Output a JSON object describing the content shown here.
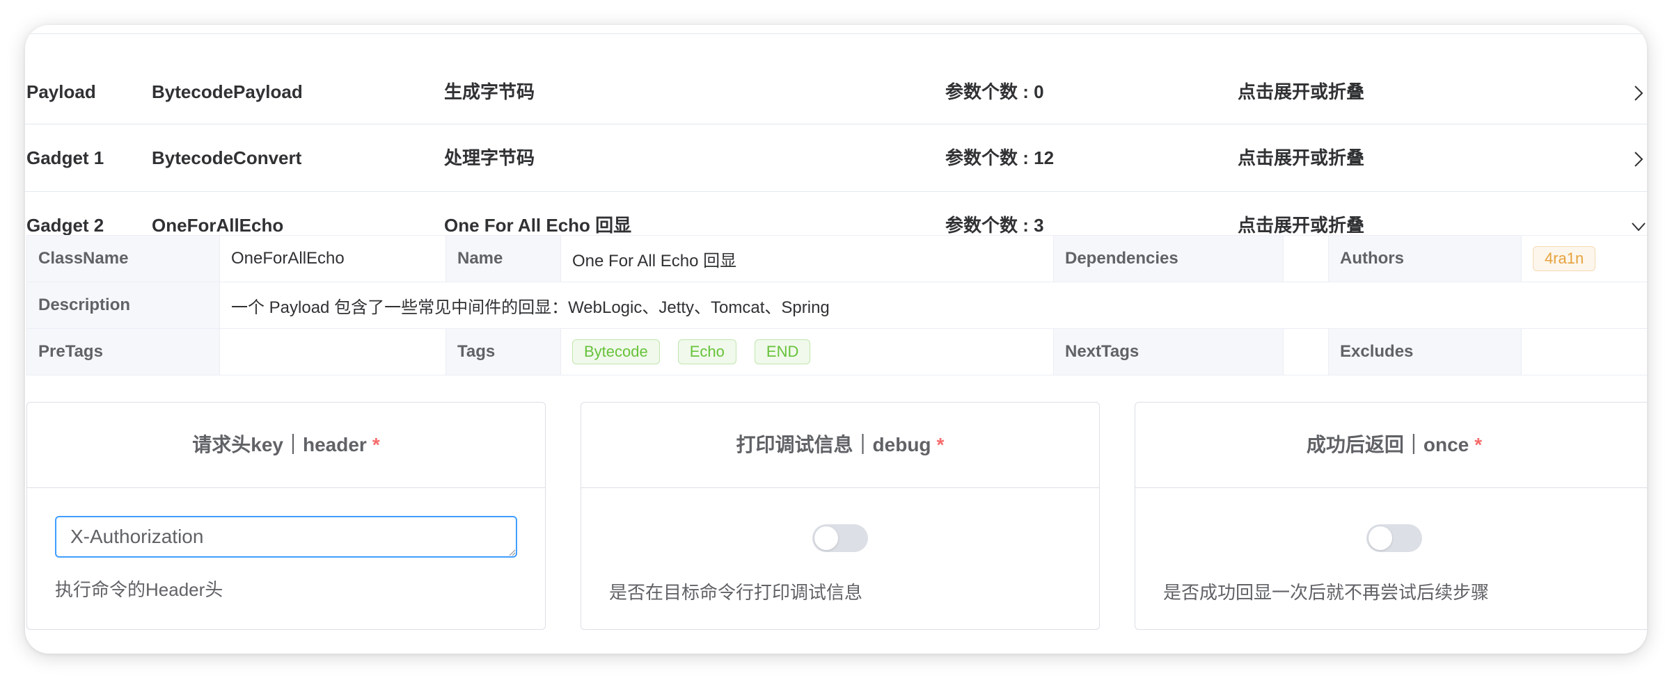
{
  "rows": [
    {
      "type": "Payload",
      "name": "BytecodePayload",
      "desc": "生成字节码",
      "params": "参数个数 : 0",
      "toggle": "点击展开或折叠",
      "expanded": false
    },
    {
      "type": "Gadget 1",
      "name": "BytecodeConvert",
      "desc": "处理字节码",
      "params": "参数个数 : 12",
      "toggle": "点击展开或折叠",
      "expanded": false
    },
    {
      "type": "Gadget 2",
      "name": "OneForAllEcho",
      "desc": "One For All Echo 回显",
      "params": "参数个数 : 3",
      "toggle": "点击展开或折叠",
      "expanded": true
    }
  ],
  "details": {
    "classname_label": "ClassName",
    "classname_value": "OneForAllEcho",
    "name_label": "Name",
    "name_value": "One For All Echo 回显",
    "dependencies_label": "Dependencies",
    "dependencies_value": "",
    "authors_label": "Authors",
    "authors": [
      "4ra1n"
    ],
    "description_label": "Description",
    "description_value": "一个 Payload 包含了一些常见中间件的回显：WebLogic、Jetty、Tomcat、Spring",
    "pretags_label": "PreTags",
    "pretags_value": "",
    "tags_label": "Tags",
    "tags": [
      "Bytecode",
      "Echo",
      "END"
    ],
    "nexttags_label": "NextTags",
    "nexttags_value": "",
    "excludes_label": "Excludes",
    "excludes_value": ""
  },
  "params": {
    "header": {
      "title": "请求头key｜header",
      "required_mark": "*",
      "value": "X-Authorization",
      "hint": "执行命令的Header头"
    },
    "debug": {
      "title": "打印调试信息｜debug",
      "required_mark": "*",
      "enabled": false,
      "hint": "是否在目标命令行打印调试信息"
    },
    "once": {
      "title": "成功后返回｜once",
      "required_mark": "*",
      "enabled": false,
      "hint": "是否成功回显一次后就不再尝试后续步骤"
    }
  },
  "colors": {
    "tag_green": "#67c23a",
    "tag_orange": "#e6a23c",
    "required": "#f56c6c",
    "input_focus_border": "#409eff",
    "switch_off": "#dcdfe6"
  },
  "icons": {
    "collapsed": "chevron-right-icon",
    "expanded": "chevron-down-icon"
  }
}
